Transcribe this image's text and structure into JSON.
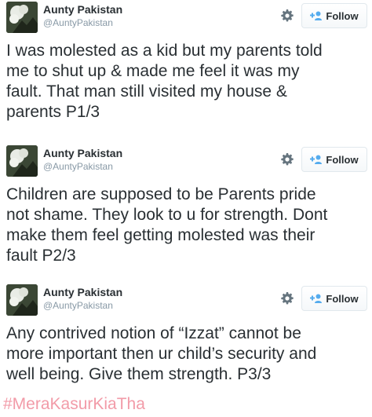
{
  "tweets": [
    {
      "name": "Aunty Pakistan",
      "handle": "@AuntyPakistan",
      "follow_label": "Follow",
      "text": "I was molested as a kid but my parents  told\nme to shut up & made me feel it was my\nfault. That man still visited my house &\nparents P1/3"
    },
    {
      "name": "Aunty Pakistan",
      "handle": "@AuntyPakistan",
      "follow_label": "Follow",
      "text": "Children are supposed to be Parents pride\nnot shame. They look to u for strength. Dont\nmake them feel getting molested was their\nfault P2/3"
    },
    {
      "name": "Aunty Pakistan",
      "handle": "@AuntyPakistan",
      "follow_label": "Follow",
      "text": "Any contrived notion of “Izzat” cannot be\nmore important then ur child’s security and\nwell being. Give them strength. P3/3"
    }
  ],
  "hashtag": "#MeraKasurKiaTha",
  "icons": {
    "settings": "gear-icon",
    "follow": "add-user-icon",
    "avatar": "profile-photo"
  },
  "colors": {
    "text": "#292f33",
    "muted": "#8899a6",
    "border": "#e1e8ed",
    "follow_accent": "#55acee",
    "hashtag": "#f29ba8"
  }
}
